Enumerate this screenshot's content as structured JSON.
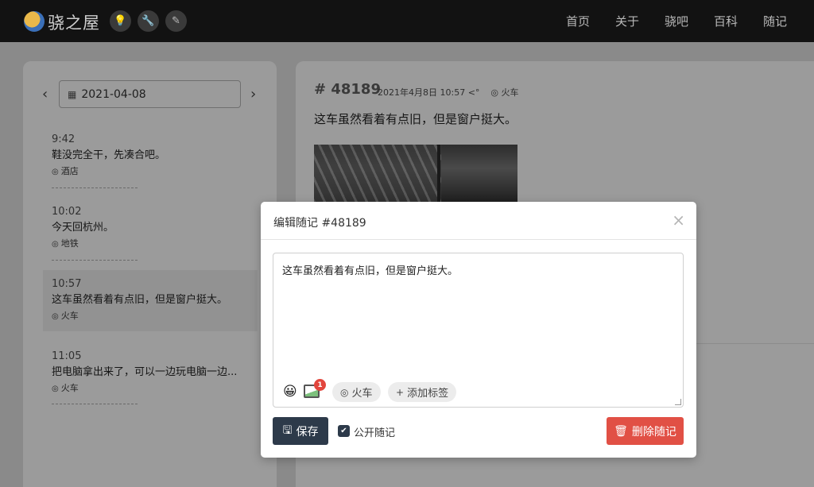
{
  "navbar": {
    "brand": "骁之屋",
    "icons": [
      "lightbulb-icon",
      "wrench-icon",
      "pencil-icon"
    ],
    "links": [
      "首页",
      "关于",
      "骁吧",
      "百科",
      "随记"
    ]
  },
  "sidebar": {
    "date": "2021-04-08",
    "prev_label": "‹",
    "next_label": "›",
    "entries": [
      {
        "time": "9:42",
        "text": "鞋没完全干，先凑合吧。",
        "location": "酒店"
      },
      {
        "time": "10:02",
        "text": "今天回杭州。",
        "location": "地铁"
      },
      {
        "time": "10:57",
        "text": "这车虽然看着有点旧，但是窗户挺大。",
        "location": "火车"
      },
      {
        "time": "11:05",
        "text": "把电脑拿出来了，可以一边玩电脑一边...",
        "location": "火车"
      }
    ]
  },
  "post": {
    "id": "# 48189",
    "datetime": "2021年4月8日 10:57",
    "location": "火车",
    "text": "这车虽然看着有点旧，但是窗户挺大。"
  },
  "modal": {
    "title": "编辑随记 #48189",
    "close_label": "×",
    "content": "这车虽然看着有点旧，但是窗户挺大。",
    "image_count": "1",
    "location_chip": "火车",
    "add_tag_label": "添加标签",
    "save_label": "保存",
    "public_label": "公开随记",
    "public_checked": true,
    "delete_label": "删除随记"
  },
  "colors": {
    "navbar_bg": "#121212",
    "save_button": "#2d3a4a",
    "delete_button": "#e15045",
    "badge": "#e2463d"
  }
}
